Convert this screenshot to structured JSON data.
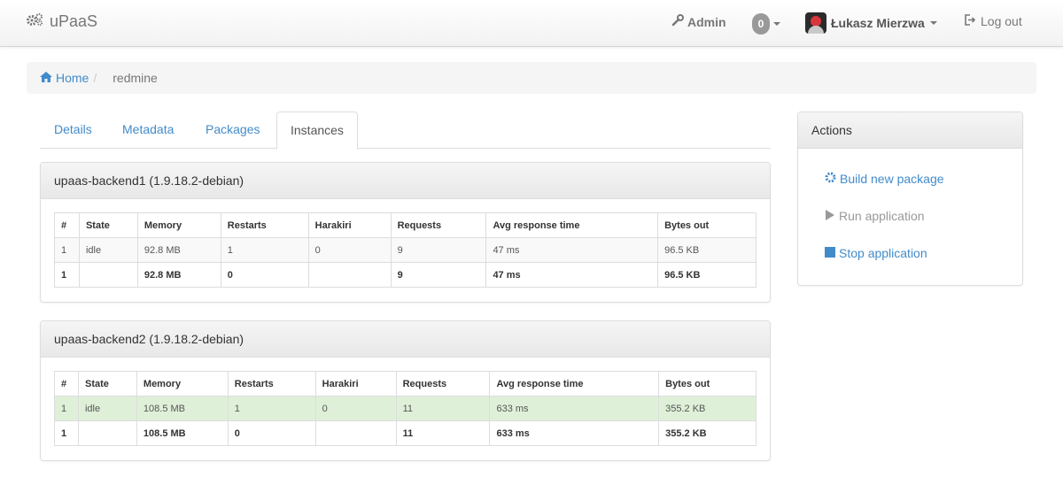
{
  "navbar": {
    "brand": "uPaaS",
    "admin_label": "Admin",
    "notifications_count": "0",
    "user_name": "Łukasz Mierzwa",
    "logout_label": "Log out"
  },
  "breadcrumb": {
    "home": "Home",
    "current": "redmine"
  },
  "tabs": [
    {
      "label": "Details"
    },
    {
      "label": "Metadata"
    },
    {
      "label": "Packages"
    },
    {
      "label": "Instances"
    }
  ],
  "columns": [
    "#",
    "State",
    "Memory",
    "Restarts",
    "Harakiri",
    "Requests",
    "Avg response time",
    "Bytes out"
  ],
  "backends": [
    {
      "title": "upaas-backend1 (1.9.18.2-debian)",
      "row": [
        "1",
        "idle",
        "92.8 MB",
        "1",
        "0",
        "9",
        "47 ms",
        "96.5 KB"
      ],
      "total": [
        "1",
        "",
        "92.8 MB",
        "0",
        "",
        "9",
        "47 ms",
        "96.5 KB"
      ]
    },
    {
      "title": "upaas-backend2 (1.9.18.2-debian)",
      "row": [
        "1",
        "idle",
        "108.5 MB",
        "1",
        "0",
        "11",
        "633 ms",
        "355.2 KB"
      ],
      "total": [
        "1",
        "",
        "108.5 MB",
        "0",
        "",
        "11",
        "633 ms",
        "355.2 KB"
      ]
    }
  ],
  "actions": {
    "title": "Actions",
    "build": "Build new package",
    "run": "Run application",
    "stop": "Stop application"
  },
  "colors": {
    "link": "#428bca",
    "success_row": "#dff0d8",
    "badge": "#999999"
  }
}
